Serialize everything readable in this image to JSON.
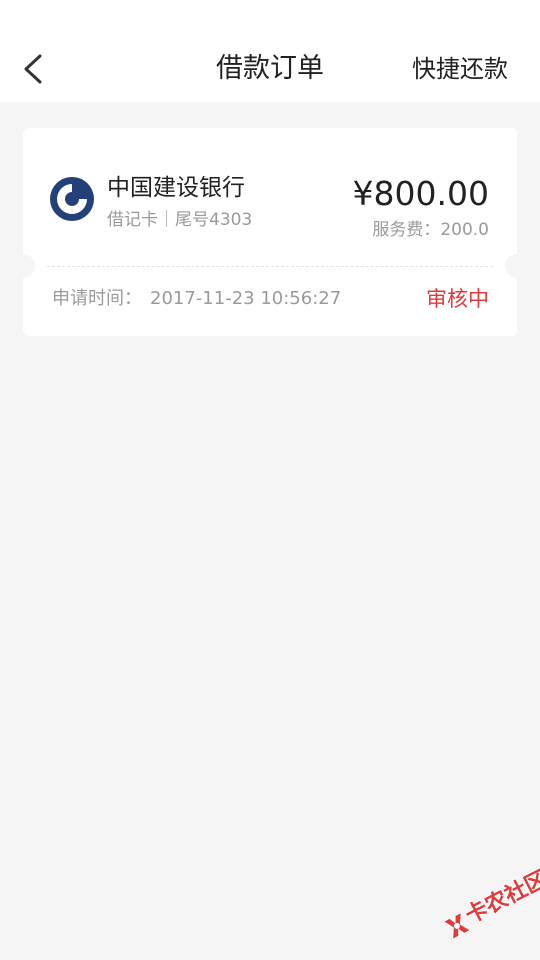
{
  "header": {
    "title": "借款订单",
    "quick_repay_label": "快捷还款"
  },
  "order": {
    "bank_name": "中国建设银行",
    "card_type": "借记卡",
    "card_tail": "尾号4303",
    "amount": "¥800.00",
    "service_fee_label": "服务费：",
    "service_fee_value": "200.0",
    "apply_time_label": "申请时间：",
    "apply_time_value": "2017-11-23 10:56:27",
    "status": "审核中"
  },
  "watermark": {
    "text": "卡农社区"
  },
  "colors": {
    "background": "#f5f5f5",
    "card": "#ffffff",
    "bank_brand": "#24407a",
    "status_red": "#e03a3a",
    "text_primary": "#222222",
    "text_secondary": "#9a9a9a"
  },
  "icons": {
    "back": "chevron-left-icon",
    "bank": "ccb-bank-logo-icon",
    "watermark": "kanong-logo-icon"
  }
}
